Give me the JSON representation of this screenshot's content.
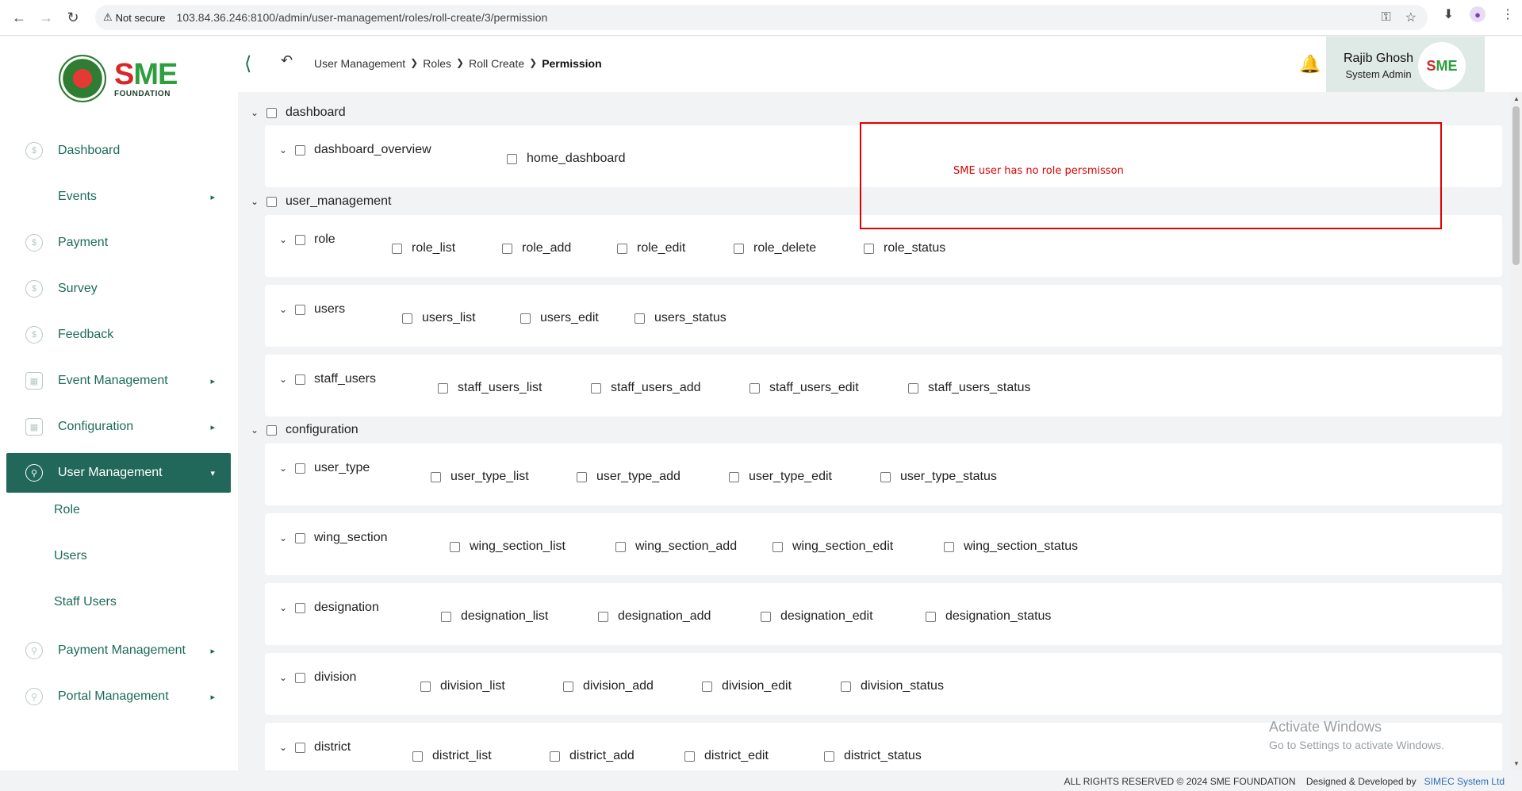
{
  "browser": {
    "not_secure": "Not secure",
    "url": "103.84.36.246:8100/admin/user-management/roles/roll-create/3/permission"
  },
  "sidebar": {
    "items": [
      {
        "label": "Dashboard"
      },
      {
        "label": "Events"
      },
      {
        "label": "Payment"
      },
      {
        "label": "Survey"
      },
      {
        "label": "Feedback"
      },
      {
        "label": "Event Management"
      },
      {
        "label": "Configuration"
      },
      {
        "label": "User Management"
      },
      {
        "label": "Payment Management"
      },
      {
        "label": "Portal Management"
      }
    ],
    "sub_items": [
      "Role",
      "Users",
      "Staff Users"
    ],
    "logo_text": "FOUNDATION"
  },
  "header": {
    "breadcrumb": [
      "User Management",
      "Roles",
      "Roll Create",
      "Permission"
    ],
    "user_name": "Rajib Ghosh",
    "user_role": "System Admin"
  },
  "permissions": {
    "dashboard": {
      "label": "dashboard",
      "rows": [
        {
          "label": "dashboard_overview",
          "perms": [
            "home_dashboard"
          ]
        }
      ]
    },
    "user_management": {
      "label": "user_management",
      "rows": [
        {
          "label": "role",
          "perms": [
            "role_list",
            "role_add",
            "role_edit",
            "role_delete",
            "role_status"
          ]
        },
        {
          "label": "users",
          "perms": [
            "users_list",
            "users_edit",
            "users_status"
          ]
        },
        {
          "label": "staff_users",
          "perms": [
            "staff_users_list",
            "staff_users_add",
            "staff_users_edit",
            "staff_users_status"
          ]
        }
      ]
    },
    "configuration": {
      "label": "configuration",
      "rows": [
        {
          "label": "user_type",
          "perms": [
            "user_type_list",
            "user_type_add",
            "user_type_edit",
            "user_type_status"
          ]
        },
        {
          "label": "wing_section",
          "perms": [
            "wing_section_list",
            "wing_section_add",
            "wing_section_edit",
            "wing_section_status"
          ]
        },
        {
          "label": "designation",
          "perms": [
            "designation_list",
            "designation_add",
            "designation_edit",
            "designation_status"
          ]
        },
        {
          "label": "division",
          "perms": [
            "division_list",
            "division_add",
            "division_edit",
            "division_status"
          ]
        },
        {
          "label": "district",
          "perms": [
            "district_list",
            "district_add",
            "district_edit",
            "district_status"
          ]
        }
      ]
    }
  },
  "annotation": {
    "text": "SME user has no role persmisson",
    "color": "#e00000"
  },
  "watermark": {
    "line1": "Activate Windows",
    "line2": "Go to Settings to activate Windows."
  },
  "footer": {
    "copyright": "ALL RIGHTS RESERVED © 2024 SME FOUNDATION",
    "designed": "Designed & Developed by",
    "company": "SIMEC System Ltd"
  },
  "colors": {
    "brand": "#21685a",
    "accent": "#1b6b5a"
  }
}
